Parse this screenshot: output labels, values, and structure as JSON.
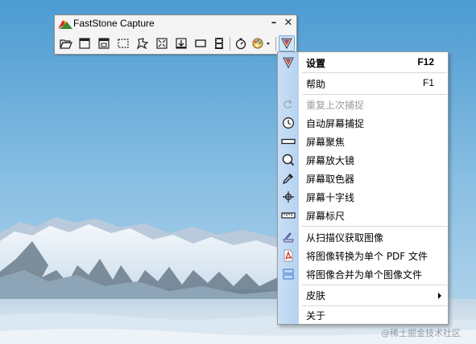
{
  "window": {
    "title": "FastStone Capture",
    "minimize_symbol": "–",
    "close_symbol": "✕"
  },
  "toolbar": {
    "tools": [
      {
        "icon": "open-folder-icon"
      },
      {
        "icon": "capture-active-window-icon"
      },
      {
        "icon": "capture-window-object-icon"
      },
      {
        "icon": "capture-rectangle-icon"
      },
      {
        "icon": "capture-freehand-icon"
      },
      {
        "icon": "capture-fullscreen-icon"
      },
      {
        "icon": "capture-scrolling-icon"
      },
      {
        "icon": "capture-fixed-region-icon"
      },
      {
        "icon": "screen-recorder-icon"
      },
      {
        "icon": "delay-timer-icon"
      },
      {
        "icon": "output-destination-icon"
      },
      {
        "icon": "settings-menu-icon"
      }
    ]
  },
  "menu": {
    "items": [
      {
        "id": "settings",
        "label": "设置",
        "shortcut": "F12",
        "icon": "settings-icon",
        "bold": true
      },
      {
        "id": "help",
        "label": "帮助",
        "shortcut": "F1"
      },
      {
        "id": "repeat-last-capture",
        "label": "重复上次捕捉",
        "icon": "repeat-capture-icon",
        "disabled": true
      },
      {
        "id": "auto-capture",
        "label": "自动屏幕捕捉",
        "icon": "clock-icon"
      },
      {
        "id": "screen-focus",
        "label": "屏幕聚焦",
        "icon": "focus-bar-icon"
      },
      {
        "id": "magnifier",
        "label": "屏幕放大镜",
        "icon": "magnifier-icon"
      },
      {
        "id": "color-picker",
        "label": "屏幕取色器",
        "icon": "eyedropper-icon"
      },
      {
        "id": "crosshair",
        "label": "屏幕十字线",
        "icon": "crosshair-icon"
      },
      {
        "id": "ruler",
        "label": "屏幕标尺",
        "icon": "ruler-icon"
      },
      {
        "id": "scanner",
        "label": "从扫描仪获取图像",
        "icon": "scanner-icon"
      },
      {
        "id": "to-pdf",
        "label": "将图像转换为单个 PDF 文件",
        "icon": "pdf-icon"
      },
      {
        "id": "merge-images",
        "label": "将图像合并为单个图像文件",
        "icon": "merge-images-icon"
      },
      {
        "id": "skin",
        "label": "皮肤",
        "submenu": true
      },
      {
        "id": "about",
        "label": "关于"
      }
    ]
  },
  "watermark": "@稀土掘金技术社区",
  "colors": {
    "menu_gutter": "#c3daf4",
    "disabled_text": "#9c9c9c",
    "active_tool": "#cfe6fa"
  }
}
